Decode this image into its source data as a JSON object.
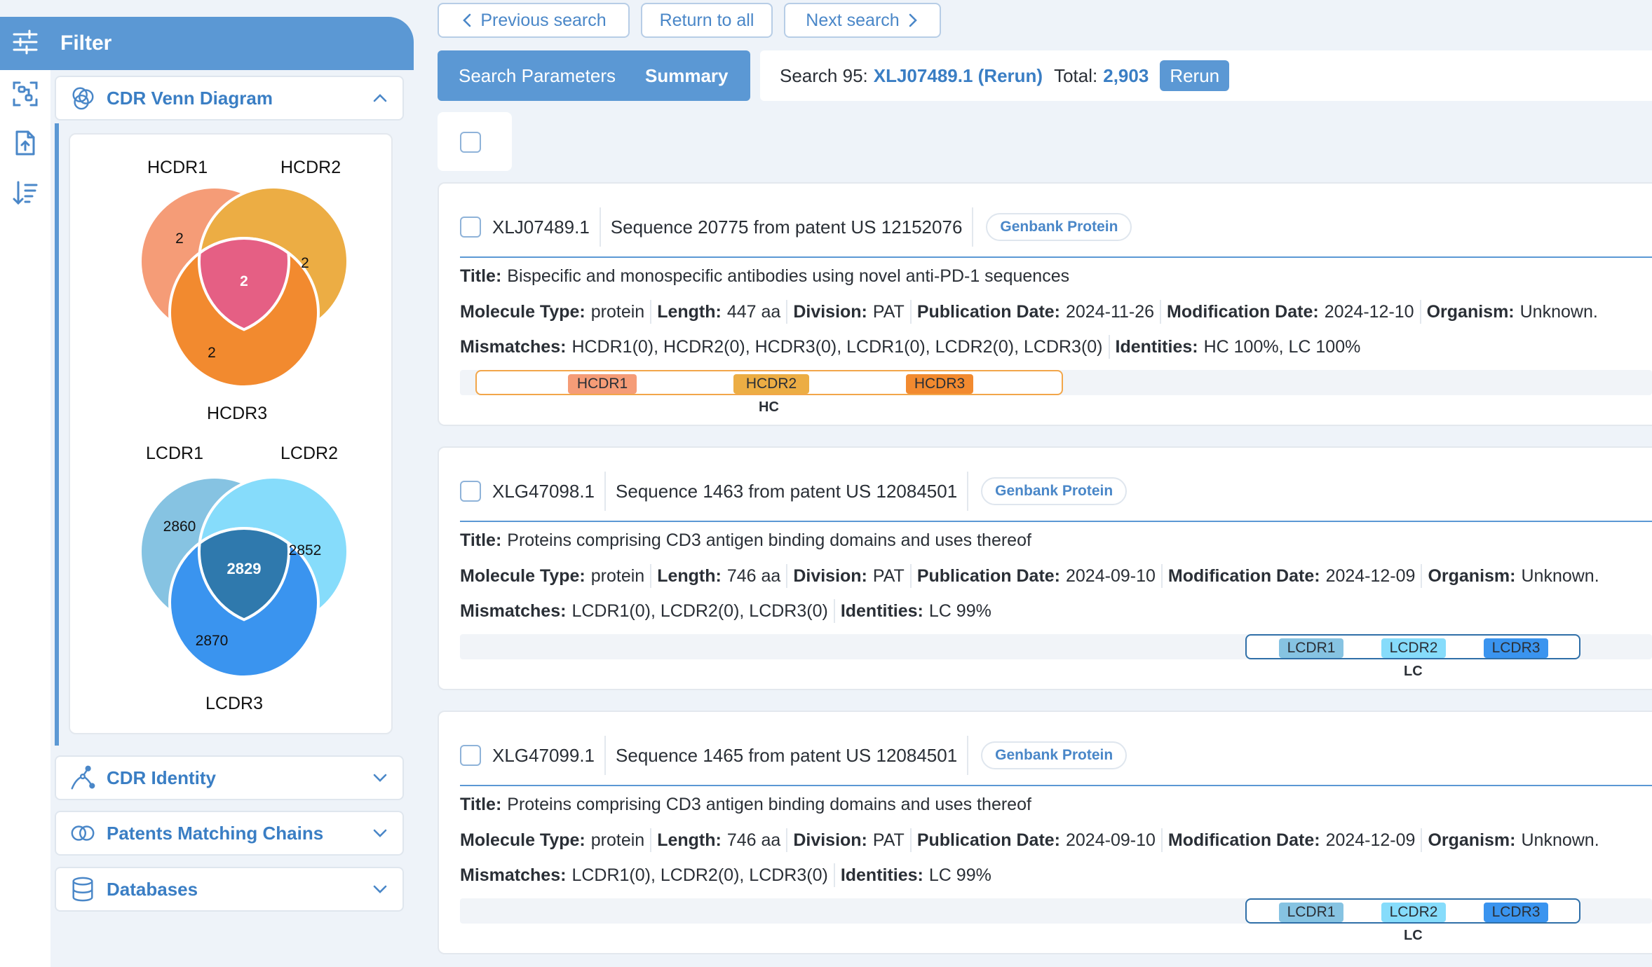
{
  "filter": {
    "title": "Filter",
    "sections": [
      {
        "label": "CDR Venn Diagram",
        "icon": "venn-rings-icon",
        "expanded": true
      },
      {
        "label": "CDR Identity",
        "icon": "identity-branch-icon",
        "expanded": false
      },
      {
        "label": "Patents Matching Chains",
        "icon": "linked-rings-icon",
        "expanded": false
      },
      {
        "label": "Databases",
        "icon": "database-icon",
        "expanded": false
      }
    ],
    "heavy_venn": {
      "labels": {
        "a": "HCDR1",
        "b": "HCDR2",
        "c": "HCDR3"
      },
      "counts": {
        "a": "2",
        "b": "2",
        "c": "2",
        "abc": "2"
      },
      "colors": {
        "a": "#f59c77",
        "b": "#ecad44",
        "c": "#f28a2f",
        "abc": "#e55f84"
      }
    },
    "light_venn": {
      "labels": {
        "a": "LCDR1",
        "b": "LCDR2",
        "c": "LCDR3"
      },
      "counts": {
        "a": "2860",
        "b": "2852",
        "c": "2870",
        "abc": "2829"
      },
      "colors": {
        "a": "#86c3e2",
        "b": "#86dcfb",
        "c": "#3a94ef",
        "abc": "#2f79ad"
      }
    }
  },
  "rail_icons": [
    "sliders-icon",
    "scan-sequence-icon",
    "upload-file-icon",
    "sort-list-icon"
  ],
  "nav": {
    "previous": "Previous search",
    "return_all": "Return to all",
    "next": "Next search"
  },
  "tabs": {
    "search_params": "Search Parameters",
    "summary": "Summary"
  },
  "search": {
    "prefix": "Search 95:",
    "query": "XLJ07489.1 (Rerun)",
    "total_label": "Total:",
    "total": "2,903",
    "rerun": "Rerun"
  },
  "results": [
    {
      "accession": "XLJ07489.1",
      "description": "Sequence 20775 from patent US 12152076",
      "database": "Genbank Protein",
      "title_label": "Title:",
      "title": "Bispecific and monospecific antibodies using novel anti-PD-1 sequences",
      "molecule_type": "protein",
      "length": "447 aa",
      "division": "PAT",
      "publication_date": "2024-11-26",
      "modification_date": "2024-12-10",
      "organism": "Unknown.",
      "mismatches": "HCDR1(0), HCDR2(0), HCDR3(0), LCDR1(0), LCDR2(0), LCDR3(0)",
      "identities": "HC 100%, LC 100%",
      "chain": "HC",
      "regions": [
        "HCDR1",
        "HCDR2",
        "HCDR3"
      ]
    },
    {
      "accession": "XLG47098.1",
      "description": "Sequence 1463 from patent US 12084501",
      "database": "Genbank Protein",
      "title_label": "Title:",
      "title": "Proteins comprising CD3 antigen binding domains and uses thereof",
      "molecule_type": "protein",
      "length": "746 aa",
      "division": "PAT",
      "publication_date": "2024-09-10",
      "modification_date": "2024-12-09",
      "organism": "Unknown.",
      "mismatches": "LCDR1(0), LCDR2(0), LCDR3(0)",
      "identities": "LC 99%",
      "chain": "LC",
      "regions": [
        "LCDR1",
        "LCDR2",
        "LCDR3"
      ]
    },
    {
      "accession": "XLG47099.1",
      "description": "Sequence 1465 from patent US 12084501",
      "database": "Genbank Protein",
      "title_label": "Title:",
      "title": "Proteins comprising CD3 antigen binding domains and uses thereof",
      "molecule_type": "protein",
      "length": "746 aa",
      "division": "PAT",
      "publication_date": "2024-09-10",
      "modification_date": "2024-12-09",
      "organism": "Unknown.",
      "mismatches": "LCDR1(0), LCDR2(0), LCDR3(0)",
      "identities": "LC 99%",
      "chain": "LC",
      "regions": [
        "LCDR1",
        "LCDR2",
        "LCDR3"
      ]
    }
  ],
  "field_labels": {
    "molecule_type": "Molecule Type:",
    "length": "Length:",
    "division": "Division:",
    "publication_date": "Publication Date:",
    "modification_date": "Modification Date:",
    "organism": "Organism:",
    "mismatches": "Mismatches:",
    "identities": "Identities:"
  },
  "colors": {
    "accent": "#5b98d4",
    "link": "#3a7ec4",
    "hcdr1": "#f59c77",
    "hcdr2": "#ecad44",
    "hcdr3": "#f28a2f",
    "hc_box_border": "#f2a64a",
    "lcdr1": "#86c3e2",
    "lcdr2": "#86dcfb",
    "lcdr3": "#3a94ef",
    "lc_box_border": "#2f6fa8"
  }
}
